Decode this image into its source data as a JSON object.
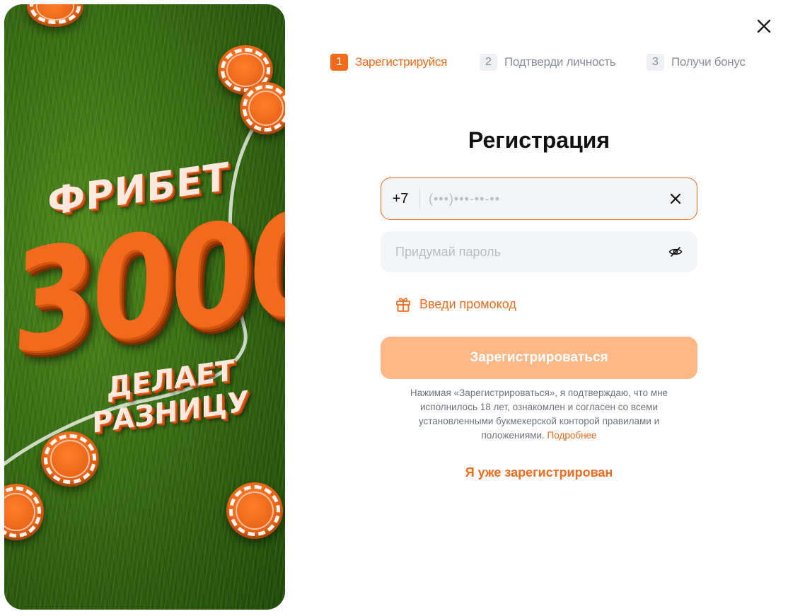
{
  "promo": {
    "line1": "ФРИБЕТ",
    "line2": "3000",
    "line3": "ДЕЛАЕТ РАЗНИЦУ"
  },
  "steps": [
    {
      "num": "1",
      "label": "Зарегистрируйся",
      "active": true
    },
    {
      "num": "2",
      "label": "Подтверди личность",
      "active": false
    },
    {
      "num": "3",
      "label": "Получи бонус",
      "active": false
    }
  ],
  "form": {
    "title": "Регистрация",
    "phone_code": "+7",
    "phone_placeholder": "(•••)•••-••-••",
    "phone_value": "",
    "password_placeholder": "Придумай пароль",
    "password_value": "",
    "promo_code_label": "Введи промокод",
    "submit_label": "Зарегистрироваться",
    "legal_text": "Нажимая «Зарегистрироваться», я подтверждаю, что мне исполнилось 18 лет, ознакомлен и согласен со всеми установленными букмекерской конторой правилами и положениями.",
    "legal_link": "Подробнее",
    "already_registered": "Я уже зарегистрирован"
  },
  "colors": {
    "accent": "#f26b1d",
    "submit_disabled": "#fdb887",
    "field_bg": "#f4f5f7"
  },
  "icons": {
    "close": "close-icon",
    "clear": "clear-icon",
    "eye": "eye-slash-icon",
    "gift": "gift-icon"
  }
}
